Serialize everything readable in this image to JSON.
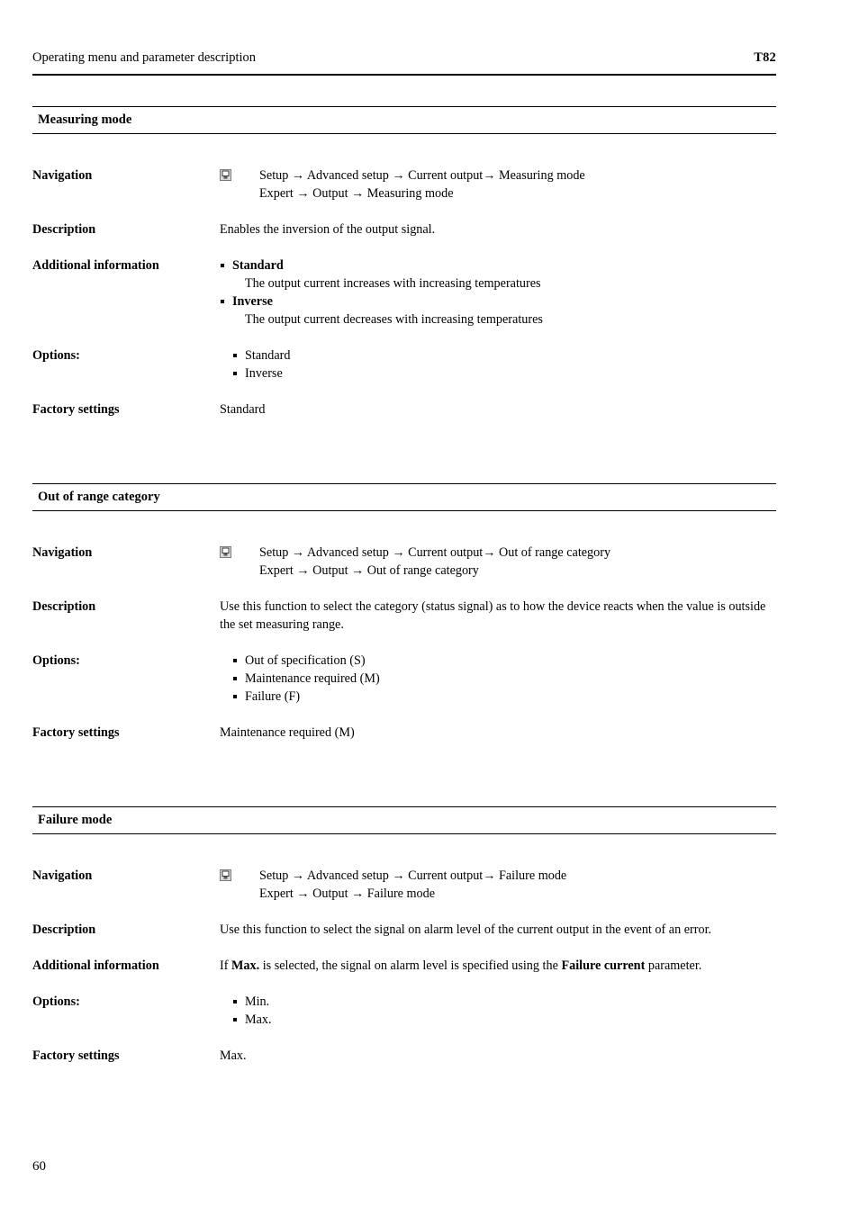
{
  "header": {
    "left_text": "Operating menu and parameter description",
    "right_text": "T82"
  },
  "footer": {
    "page_number": "60"
  },
  "labels": {
    "navigation": "Navigation",
    "description": "Description",
    "additional_information": "Additional information",
    "options": "Options:",
    "factory_settings": "Factory settings"
  },
  "icons": {
    "navigation_device": "display-device-icon"
  },
  "sections": [
    {
      "title": "Measuring mode",
      "navigation": [
        "Setup → Advanced setup → Current output→ Measuring mode",
        "Expert → Output → Measuring mode"
      ],
      "description": "Enables the inversion of the output signal.",
      "additional_information": [
        {
          "term": "Standard",
          "detail": "The output current increases with increasing temperatures"
        },
        {
          "term": "Inverse",
          "detail": "The output current decreases with increasing temperatures"
        }
      ],
      "options": [
        "Standard",
        "Inverse"
      ],
      "factory_settings": "Standard"
    },
    {
      "title": "Out of range category",
      "navigation": [
        "Setup → Advanced setup → Current output→ Out of range category",
        "Expert → Output → Out of range category"
      ],
      "description": "Use this function to select the category (status signal) as to how the device reacts when the value is outside the set measuring range.",
      "options": [
        "Out of specification (S)",
        "Maintenance required (M)",
        "Failure (F)"
      ],
      "factory_settings": "Maintenance required (M)"
    },
    {
      "title": "Failure mode",
      "navigation": [
        "Setup → Advanced setup → Current output→ Failure mode",
        "Expert → Output → Failure mode"
      ],
      "description": "Use this function to select the signal on alarm level of the current output in the event of an error.",
      "additional_information_rich": {
        "part1": "If ",
        "bold1": "Max.",
        "part2": " is selected, the signal on alarm level is specified using the ",
        "bold2": "Failure current",
        "part3": " parameter."
      },
      "options": [
        "Min.",
        "Max."
      ],
      "factory_settings": "Max."
    }
  ]
}
